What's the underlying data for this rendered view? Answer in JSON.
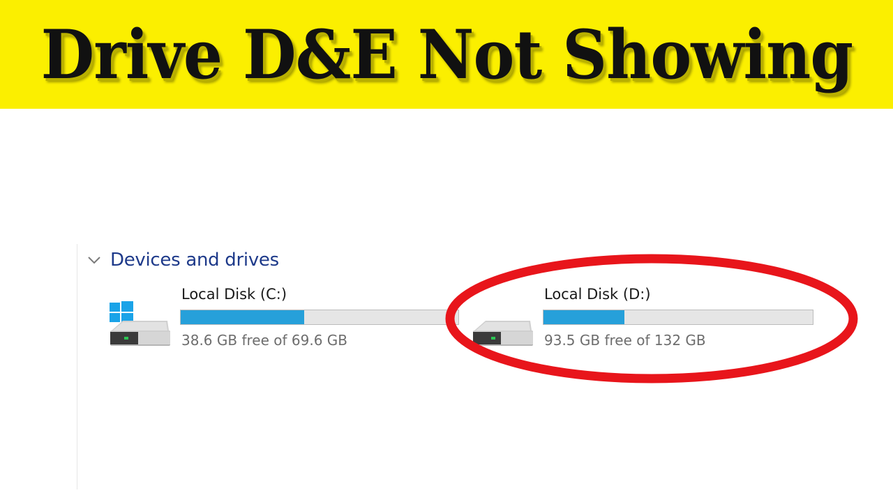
{
  "banner": {
    "title": "Drive D&E Not Showing",
    "background": "#fbef00"
  },
  "explorer": {
    "group": {
      "label": "Devices and drives",
      "expanded": true,
      "icon": "chevron-down-icon"
    },
    "drives": [
      {
        "name": "Local Disk (C:)",
        "free_text": "38.6 GB free of 69.6 GB",
        "used_fraction": 0.445,
        "icon": "windows-system-drive-icon"
      },
      {
        "name": "Local Disk (D:)",
        "free_text": "93.5 GB free of 132 GB",
        "used_fraction": 0.3,
        "icon": "hard-drive-icon",
        "highlighted": true
      }
    ]
  },
  "colors": {
    "usage_bar": "#26a0da",
    "usage_track": "#e6e6e6",
    "group_label": "#1e3a8a",
    "highlight_ring": "#e8151b"
  }
}
